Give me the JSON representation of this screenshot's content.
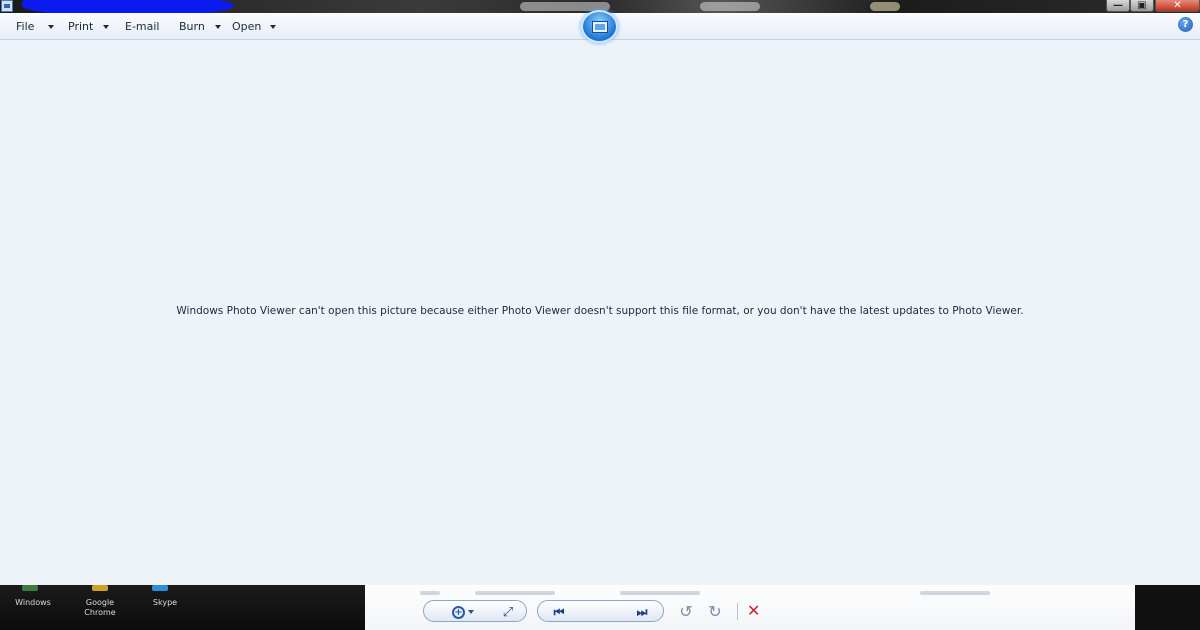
{
  "menu": {
    "items": [
      {
        "label": "File"
      },
      {
        "label": "Print"
      },
      {
        "label": "E-mail"
      },
      {
        "label": "Burn"
      },
      {
        "label": "Open"
      }
    ],
    "help_glyph": "?"
  },
  "window_controls": {
    "minimize": "—",
    "maximize": "▣",
    "close": "✕"
  },
  "viewer": {
    "message": "Windows Photo Viewer can't open this picture because either Photo Viewer doesn't support this file format, or you don't have the latest updates to Photo Viewer."
  },
  "desktop_icons": [
    {
      "label": "Windows"
    },
    {
      "label": "Google Chrome"
    },
    {
      "label": "Skype"
    }
  ],
  "toolbar": {
    "zoom_glyph": "+",
    "fit_glyph": "⤢",
    "prev_glyph": "⏮",
    "next_glyph": "⏭",
    "rotate_ccw_glyph": "↺",
    "rotate_cw_glyph": "↻",
    "delete_glyph": "✕"
  },
  "colors": {
    "accent": "#2b59a6",
    "delete": "#c62828",
    "background": "#eef3fa"
  }
}
